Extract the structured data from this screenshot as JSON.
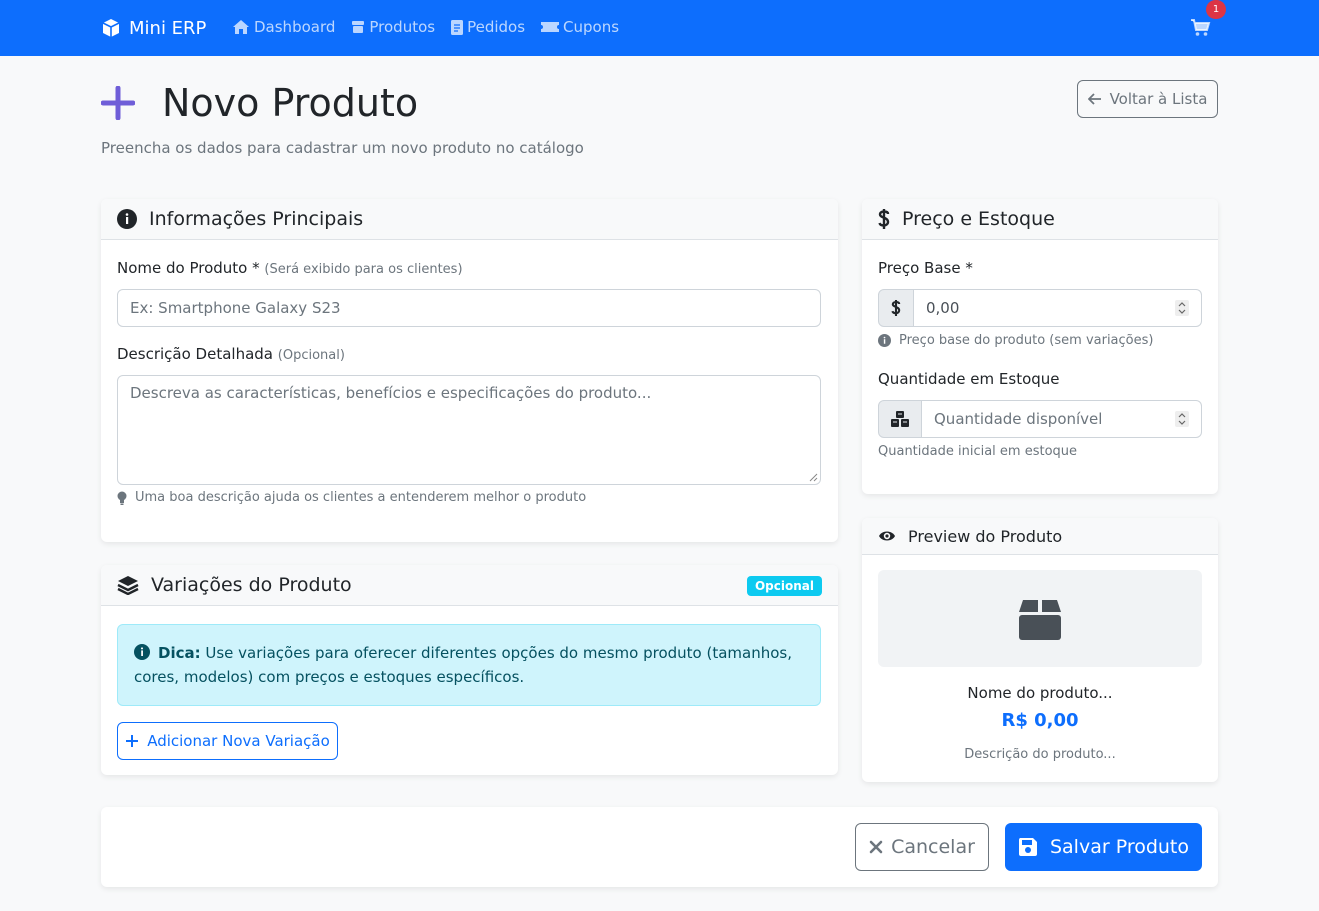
{
  "navbar": {
    "brand": "Mini ERP",
    "items": [
      {
        "label": "Dashboard",
        "icon": "home-icon"
      },
      {
        "label": "Produtos",
        "icon": "box-icon"
      },
      {
        "label": "Pedidos",
        "icon": "document-icon"
      },
      {
        "label": "Cupons",
        "icon": "ticket-icon"
      }
    ],
    "cart_count": "1",
    "bg_color": "#0d6efd"
  },
  "header": {
    "title": "Novo Produto",
    "subtitle": "Preencha os dados para cadastrar um novo produto no catálogo",
    "back_label": "Voltar à Lista"
  },
  "main_info": {
    "title": "Informações Principais",
    "name_label": "Nome do Produto *",
    "name_hint": "(Será exibido para os clientes)",
    "name_placeholder": "Ex: Smartphone Galaxy S23",
    "desc_label": "Descrição Detalhada",
    "desc_hint": "(Opcional)",
    "desc_placeholder": "Descreva as características, benefícios e especificações do produto...",
    "desc_help": "Uma boa descrição ajuda os clientes a entenderem melhor o produto"
  },
  "variations": {
    "title": "Variações do Produto",
    "badge": "Opcional",
    "tip_bold": "Dica:",
    "tip_text": "Use variações para oferecer diferentes opções do mesmo produto (tamanhos, cores, modelos) com preços e estoques específicos.",
    "add_label": "Adicionar Nova Variação"
  },
  "pricing": {
    "title": "Preço e Estoque",
    "price_label": "Preço Base *",
    "price_value": "0,00",
    "price_help": "Preço base do produto (sem variações)",
    "qty_label": "Quantidade em Estoque",
    "qty_placeholder": "Quantidade disponível",
    "qty_help": "Quantidade inicial em estoque"
  },
  "preview": {
    "title": "Preview do Produto",
    "name": "Nome do produto...",
    "price": "R$ 0,00",
    "desc": "Descrição do produto..."
  },
  "footer": {
    "cancel_label": "Cancelar",
    "save_label": "Salvar Produto"
  }
}
